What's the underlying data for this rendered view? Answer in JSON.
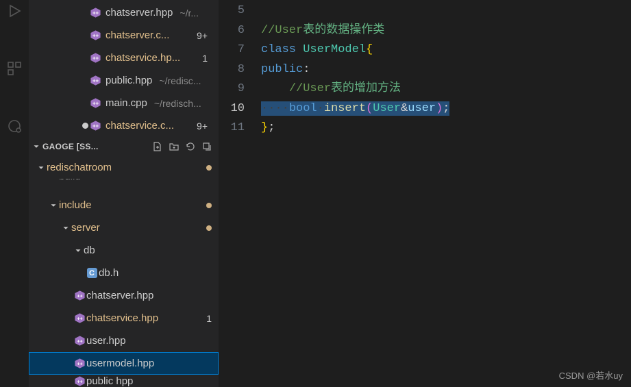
{
  "activity": {
    "icons": [
      "run-debug-icon",
      "extensions-pieces-icon",
      "remote-icon"
    ]
  },
  "open_editors": [
    {
      "name": "chatserver.hpp",
      "path": "~/r...",
      "dirty": false,
      "badge": ""
    },
    {
      "name": "chatserver.c...",
      "path": "",
      "dirty": true,
      "badge": "9+"
    },
    {
      "name": "chatservice.hp...",
      "path": "",
      "dirty": true,
      "badge": "1"
    },
    {
      "name": "public.hpp",
      "path": "~/redisc...",
      "dirty": false,
      "badge": ""
    },
    {
      "name": "main.cpp",
      "path": "~/redisch...",
      "dirty": false,
      "badge": ""
    },
    {
      "name": "chatservice.c...",
      "path": "",
      "dirty": true,
      "badge": "9+",
      "unsaved": true
    }
  ],
  "explorer": {
    "title": "GAOGE [SS...",
    "actions": [
      "new-file-icon",
      "new-folder-icon",
      "refresh-icon",
      "collapse-icon"
    ]
  },
  "tree": {
    "root": "redischatroom",
    "build": "build",
    "include": "include",
    "server": "server",
    "db": "db",
    "dbh": "db.h",
    "chatserver": "chatserver.hpp",
    "chatservice": "chatservice.hpp",
    "chatservice_badge": "1",
    "user": "user.hpp",
    "usermodel": "usermodel.hpp",
    "publichpp": "public hpp"
  },
  "code": {
    "lines": {
      "5": "",
      "6_comment": "//User表的数据操作类",
      "7_class": "class",
      "7_type": "UserModel",
      "8_public": "public",
      "9_comment": "//User表的增加方法",
      "10_bool": "bool",
      "10_func": "insert",
      "10_type": "User",
      "10_amp": "&",
      "10_param": "user",
      "11_brace": "}"
    },
    "linenos": [
      "5",
      "6",
      "7",
      "8",
      "9",
      "10",
      "11"
    ]
  },
  "watermark": "CSDN @若水uy"
}
